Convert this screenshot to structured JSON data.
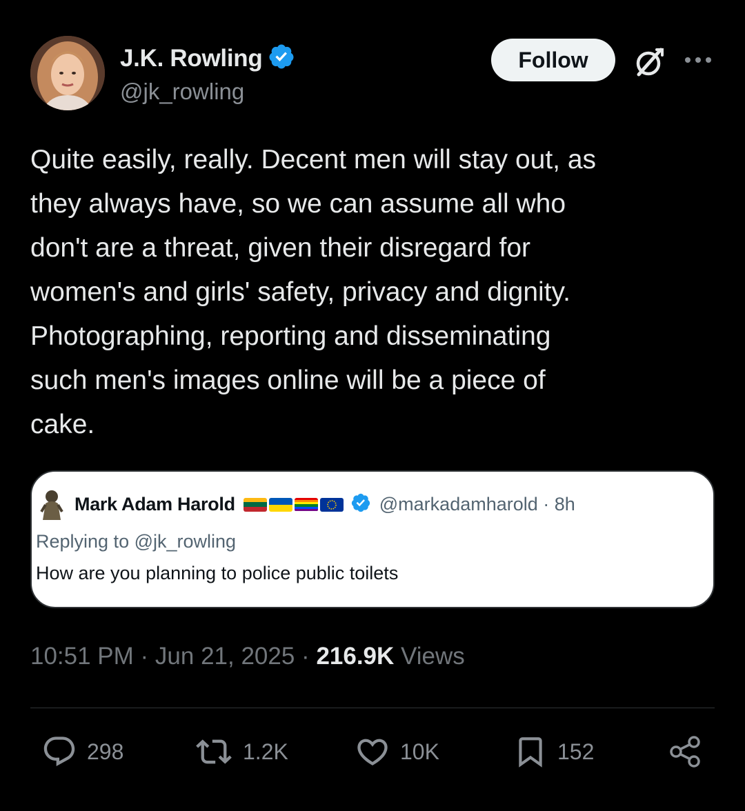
{
  "author": {
    "name": "J.K. Rowling",
    "handle": "@jk_rowling",
    "verified": true
  },
  "header": {
    "follow_label": "Follow"
  },
  "tweet": {
    "text": "Quite easily, really. Decent men will stay out, as\nthey always have, so we can assume all who\ndon't are a threat, given their disregard for\nwomen's and girls' safety, privacy and dignity.\nPhotographing, reporting and disseminating\nsuch men's images online will be a piece of\ncake."
  },
  "quote": {
    "name": "Mark Adam Harold",
    "handle_time": "@markadamharold · 8h",
    "replying_to": "Replying to @jk_rowling",
    "text": "How are you planning to police public toilets"
  },
  "meta": {
    "time": "10:51 PM",
    "sep1": " · ",
    "date": "Jun 21, 2025",
    "sep2": " · ",
    "views_count": "216.9K",
    "views_label": " Views"
  },
  "actions": {
    "replies": "298",
    "reposts": "1.2K",
    "likes": "10K",
    "bookmarks": "152"
  },
  "colors": {
    "background": "#000000",
    "verified_badge": "#1d9bf0",
    "follow_bg": "#eff3f4",
    "secondary_text": "#71767b"
  },
  "icons": [
    "verified-badge-icon",
    "grok-icon",
    "more-icon",
    "reply-icon",
    "repost-icon",
    "like-icon",
    "bookmark-icon",
    "share-icon"
  ]
}
